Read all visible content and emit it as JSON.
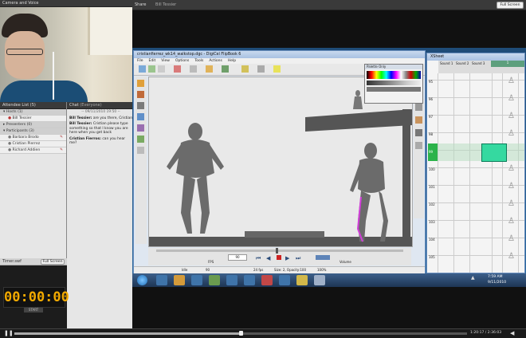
{
  "camera": {
    "title": "Camera and Voice"
  },
  "share": {
    "title": "Share",
    "presenter": "Bill Tessier",
    "fullscreen": "Full Screen"
  },
  "attendees": {
    "title": "Attendee List",
    "count": "(5)",
    "groups": [
      {
        "label": "Hosts (1)",
        "users": [
          "Bill Tessier"
        ]
      },
      {
        "label": "Presenters (0)",
        "users": []
      },
      {
        "label": "Participants (3)",
        "users": [
          "Barbara Brodo",
          "Cristian Pierrez",
          "Richard Addien"
        ]
      }
    ]
  },
  "chat": {
    "title": "Chat",
    "scope": "(Everyone)",
    "date": "-- 09/11/2010 19:50 --",
    "messages": [
      {
        "from": "Bill Tessier:",
        "text": "are you there, Cristian"
      },
      {
        "from": "Bill Tessier:",
        "text": "Cristian please type something so that I know you are here when you get back"
      },
      {
        "from": "Cristian Fierros:",
        "text": "can you hear me?"
      }
    ]
  },
  "timer": {
    "title": "Timer.swf",
    "fullscreen": "Full Screen",
    "time": "00:00:00",
    "start": "START"
  },
  "app": {
    "title": "cristianfierrez_wk14_walkstop.dgc - DigiCel FlipBook 6",
    "menus": [
      "File",
      "Edit",
      "View",
      "Options",
      "Tools",
      "Actions",
      "Help"
    ],
    "frame_value": "90",
    "fps_label": "FPS",
    "volume_label": "Volume",
    "status": [
      "Idle",
      "90",
      "24 fps",
      "Size: 2, Opacity:100",
      "100%"
    ]
  },
  "palette": {
    "title": "Palette Only"
  },
  "xsheet": {
    "title": "XSheet",
    "columns": [
      "Sound 1",
      "Sound 2",
      "Sound 3",
      "1"
    ],
    "rows": [
      "95",
      "96",
      "97",
      "98",
      "99",
      "100",
      "101",
      "102",
      "103",
      "104",
      "105"
    ]
  },
  "taskbar": {
    "time": "7:59 AM",
    "date": "9/11/2010"
  },
  "playback": {
    "timecode": "1:20:17 / 2:36:03"
  }
}
